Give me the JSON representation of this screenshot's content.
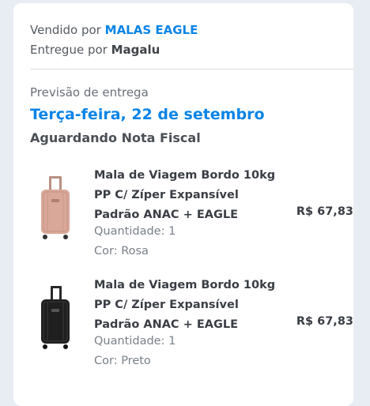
{
  "seller": {
    "prefix": "Vendido por",
    "name": "MALAS EAGLE"
  },
  "delivery": {
    "prefix": "Entregue por",
    "carrier": "Magalu"
  },
  "forecast": {
    "label": "Previsão de entrega",
    "date": "Terça-feira, 22 de setembro",
    "status": "Aguardando Nota Fiscal"
  },
  "items": [
    {
      "name_line1": "Mala de Viagem Bordo 10kg",
      "name_line2": "PP C/ Zíper Expansível",
      "name_line3": "Padrão ANAC + EAGLE",
      "price": "R$ 67,83",
      "quantity": "Quantidade: 1",
      "color": "Cor: Rosa",
      "icon": "pink-suitcase-image",
      "body_color": "#d9a899"
    },
    {
      "name_line1": "Mala de Viagem Bordo 10kg",
      "name_line2": "PP C/ Zíper Expansível",
      "name_line3": "Padrão ANAC + EAGLE",
      "price": "R$ 67,83",
      "quantity": "Quantidade: 1",
      "color": "Cor: Preto",
      "icon": "black-suitcase-image",
      "body_color": "#1f1f1f"
    }
  ],
  "colors": {
    "accent": "#0a84e6",
    "background": "#e8edf3",
    "card": "#ffffff"
  }
}
